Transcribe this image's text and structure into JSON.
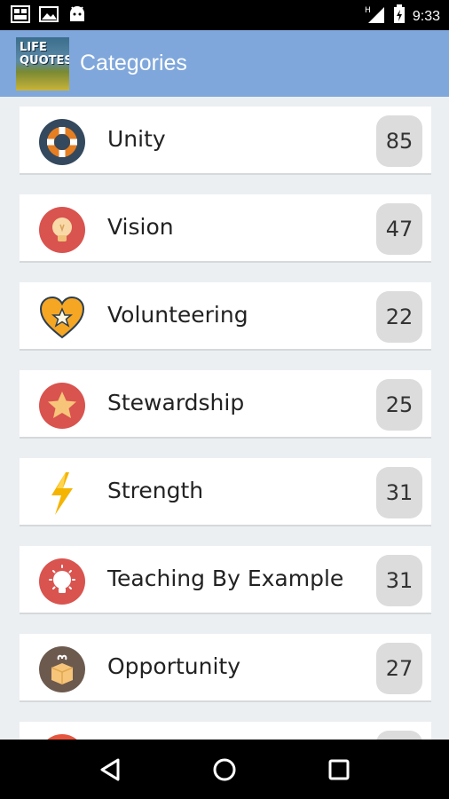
{
  "status_bar": {
    "time": "9:33",
    "icons": [
      "gallery-icon",
      "image-icon",
      "android-icon",
      "signal-icon",
      "battery-icon"
    ]
  },
  "app_bar": {
    "logo_text_line1": "LIFE",
    "logo_text_line2": "QUOTES",
    "title": "Categories"
  },
  "categories": [
    {
      "label": "Unity",
      "count": "85",
      "icon": "lifebuoy-icon",
      "color": "#2c3e50"
    },
    {
      "label": "Vision",
      "count": "47",
      "icon": "lightbulb-icon",
      "color": "#d9534f"
    },
    {
      "label": "Volunteering",
      "count": "22",
      "icon": "heart-star-icon",
      "color": "#f5a623"
    },
    {
      "label": "Stewardship",
      "count": "25",
      "icon": "star-icon",
      "color": "#d9534f"
    },
    {
      "label": "Strength",
      "count": "31",
      "icon": "lightning-icon",
      "color": "#f5b400"
    },
    {
      "label": "Teaching By Example",
      "count": "31",
      "icon": "bright-bulb-icon",
      "color": "#d9534f"
    },
    {
      "label": "Opportunity",
      "count": "27",
      "icon": "gift-box-icon",
      "color": "#6d5a4f"
    }
  ],
  "nav_bar": {
    "buttons": [
      "back-icon",
      "home-icon",
      "recents-icon"
    ]
  }
}
